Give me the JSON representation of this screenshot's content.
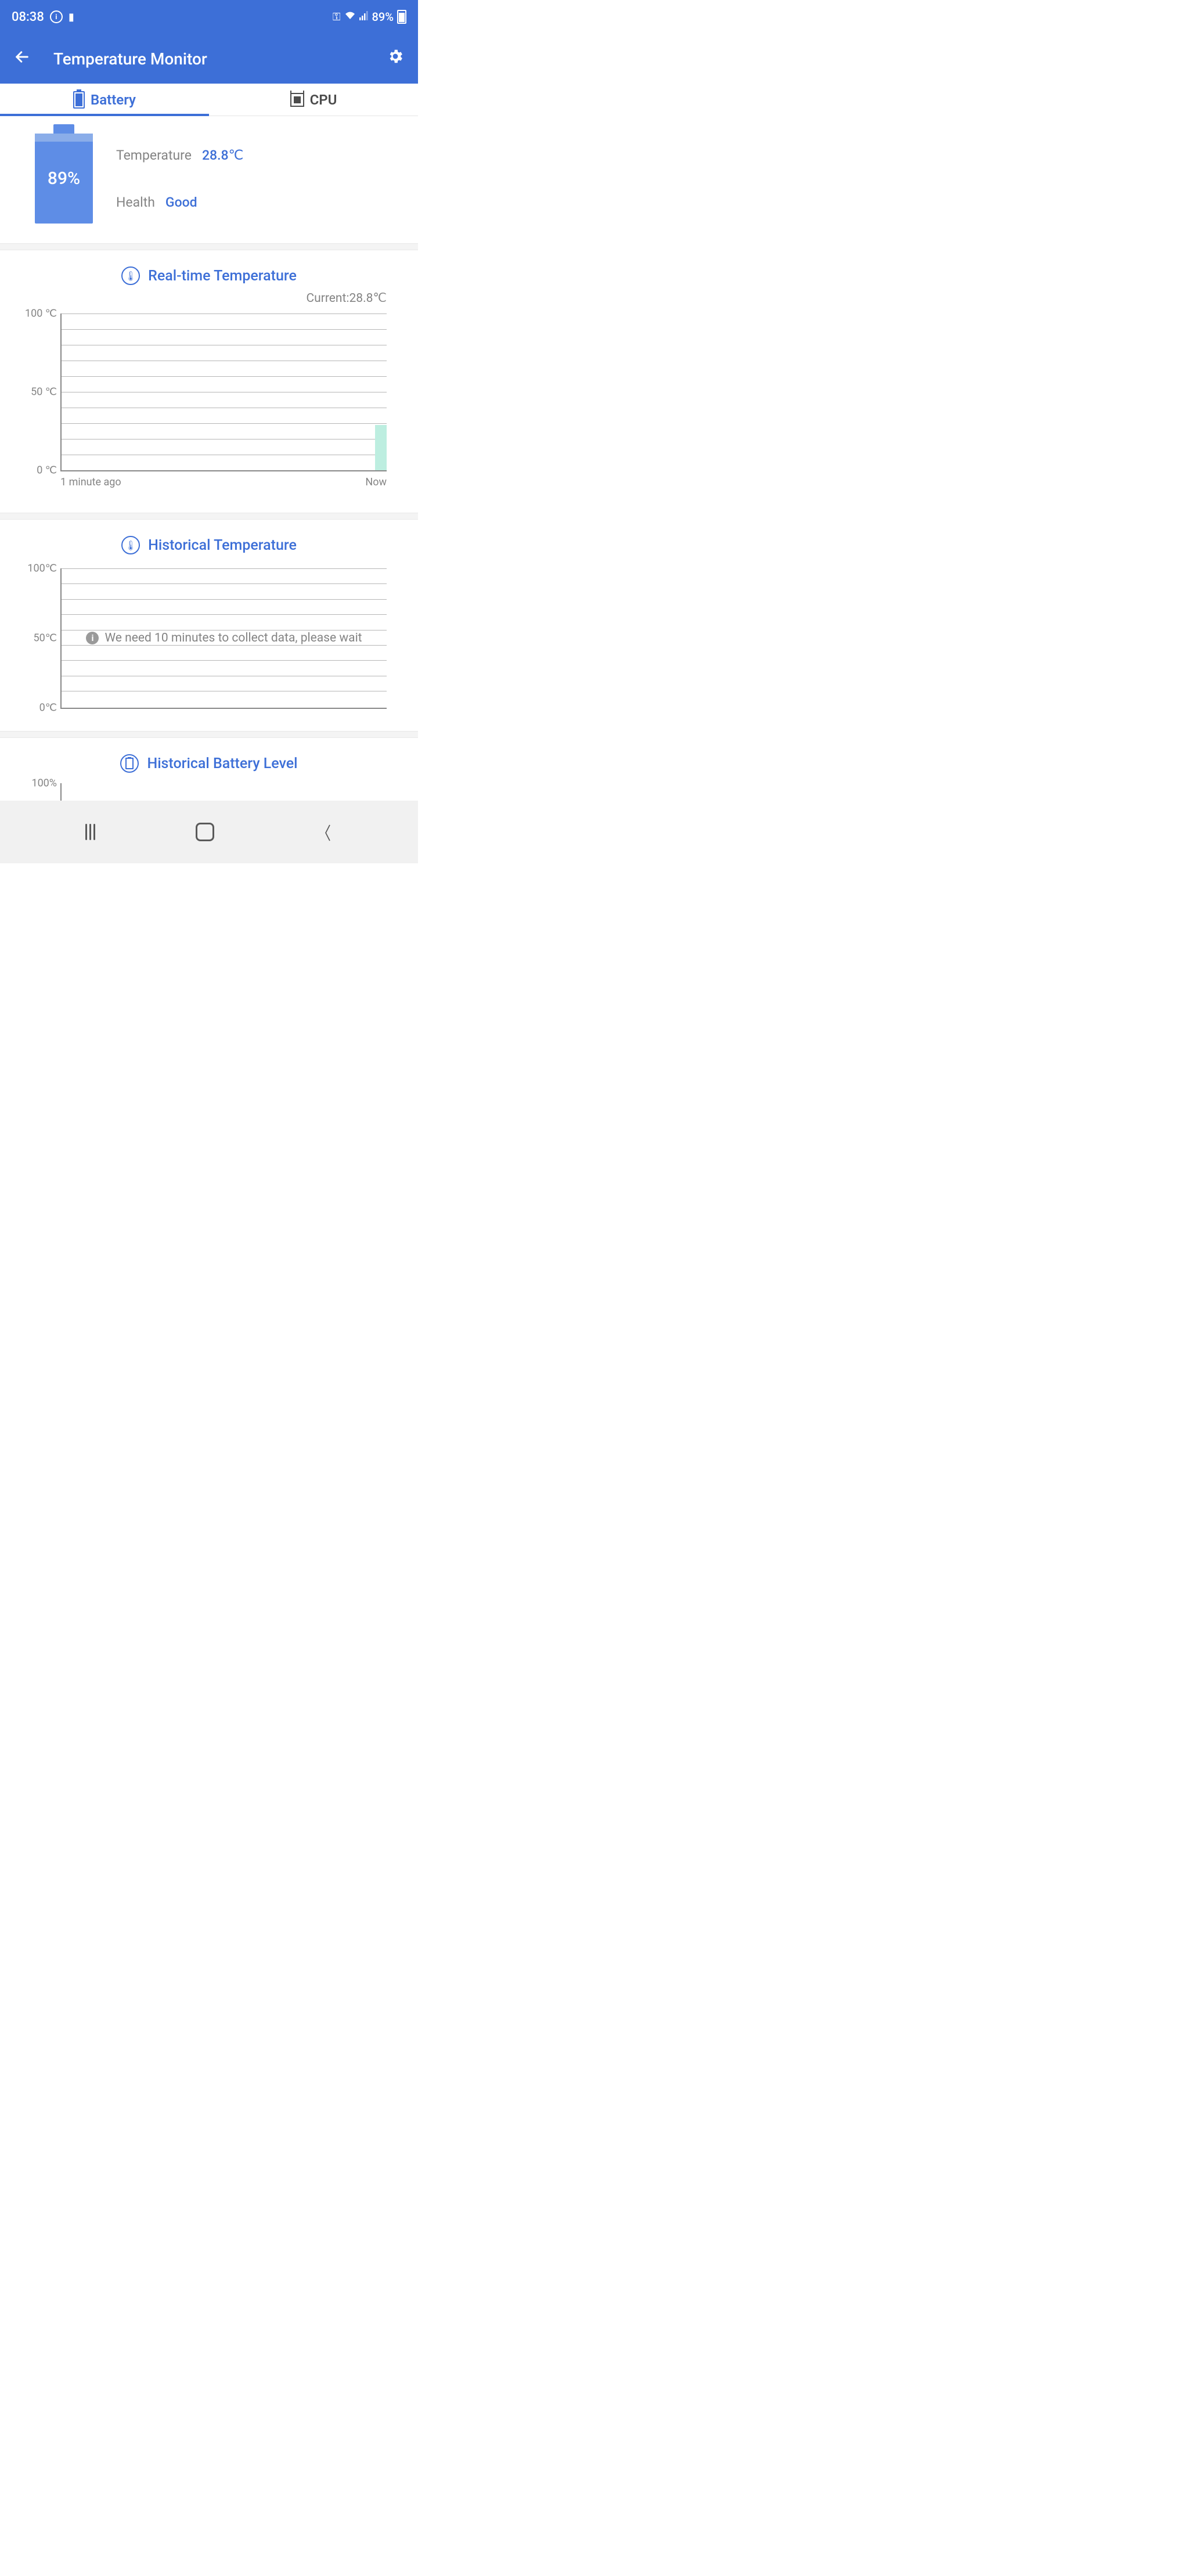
{
  "status_bar": {
    "time": "08:38",
    "battery_pct": "89%"
  },
  "app_bar": {
    "title": "Temperature Monitor"
  },
  "tabs": {
    "battery": "Battery",
    "cpu": "CPU"
  },
  "summary": {
    "battery_pct": "89%",
    "temp_label": "Temperature",
    "temp_value": "28.8℃",
    "health_label": "Health",
    "health_value": "Good"
  },
  "realtime": {
    "title": "Real-time Temperature",
    "current_label": "Current:28.8℃",
    "yticks": [
      "100 ℃",
      "50 ℃",
      "0 ℃"
    ],
    "xlabels": [
      "1 minute ago",
      "Now"
    ]
  },
  "historical": {
    "title": "Historical Temperature",
    "yticks": [
      "100℃",
      "50℃",
      "0℃"
    ],
    "message": "We need 10 minutes to collect data, please wait"
  },
  "battery_level": {
    "title": "Historical Battery Level",
    "ytick": "100%"
  },
  "chart_data": [
    {
      "type": "line",
      "title": "Real-time Temperature",
      "ylabel": "℃",
      "ylim": [
        0,
        100
      ],
      "x": [
        "1 minute ago",
        "Now"
      ],
      "series": [
        {
          "name": "Temperature",
          "values": [
            null,
            28.8
          ]
        }
      ],
      "current": 28.8
    },
    {
      "type": "line",
      "title": "Historical Temperature",
      "ylabel": "℃",
      "ylim": [
        0,
        100
      ],
      "series": [
        {
          "name": "Temperature",
          "values": []
        }
      ],
      "note": "We need 10 minutes to collect data, please wait"
    },
    {
      "type": "line",
      "title": "Historical Battery Level",
      "ylabel": "%",
      "ylim": [
        0,
        100
      ],
      "series": [
        {
          "name": "Battery",
          "values": []
        }
      ]
    }
  ]
}
